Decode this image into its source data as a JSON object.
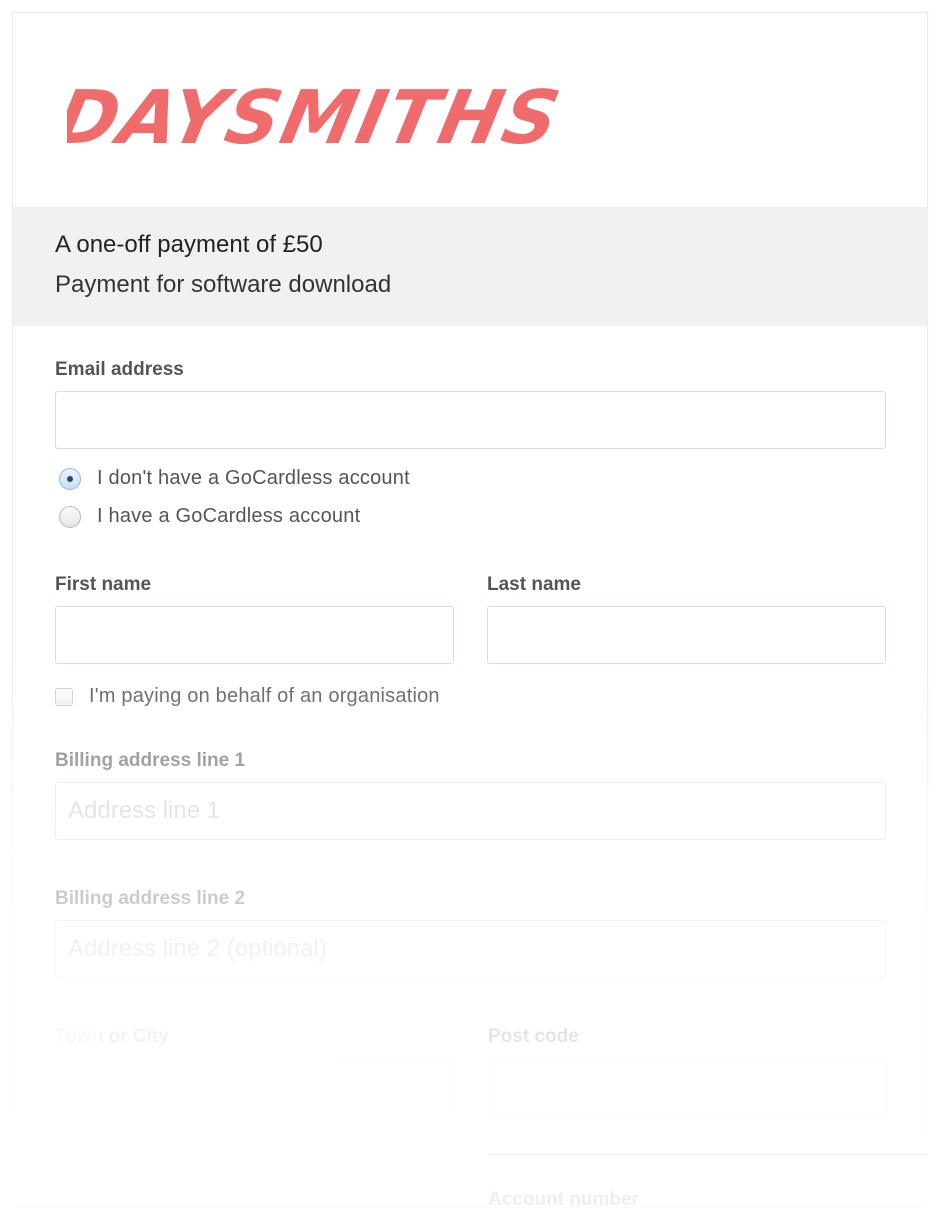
{
  "brand": {
    "logo_text": "DAYSMITHS",
    "logo_color": "#f06b6b"
  },
  "summary": {
    "title": "A one-off payment of £50",
    "description": "Payment for software download"
  },
  "form": {
    "email_label": "Email address",
    "email_value": "",
    "account_options": [
      {
        "label": "I don't have a GoCardless account",
        "selected": true
      },
      {
        "label": "I have a GoCardless account",
        "selected": false
      }
    ],
    "first_name_label": "First name",
    "last_name_label": "Last name",
    "organisation_label": "I'm paying on behalf of an organisation",
    "billing1_label": "Billing address line 1",
    "billing1_placeholder": "Address line 1",
    "billing2_label": "Billing address line 2",
    "billing2_placeholder": "Address line 2 (optional)",
    "town_label": "Town or City",
    "postcode_label": "Post code",
    "account_number_label": "Account number"
  },
  "colors": {
    "accent_border": "#cfe0ea",
    "summary_bg": "#f1f1f1"
  }
}
